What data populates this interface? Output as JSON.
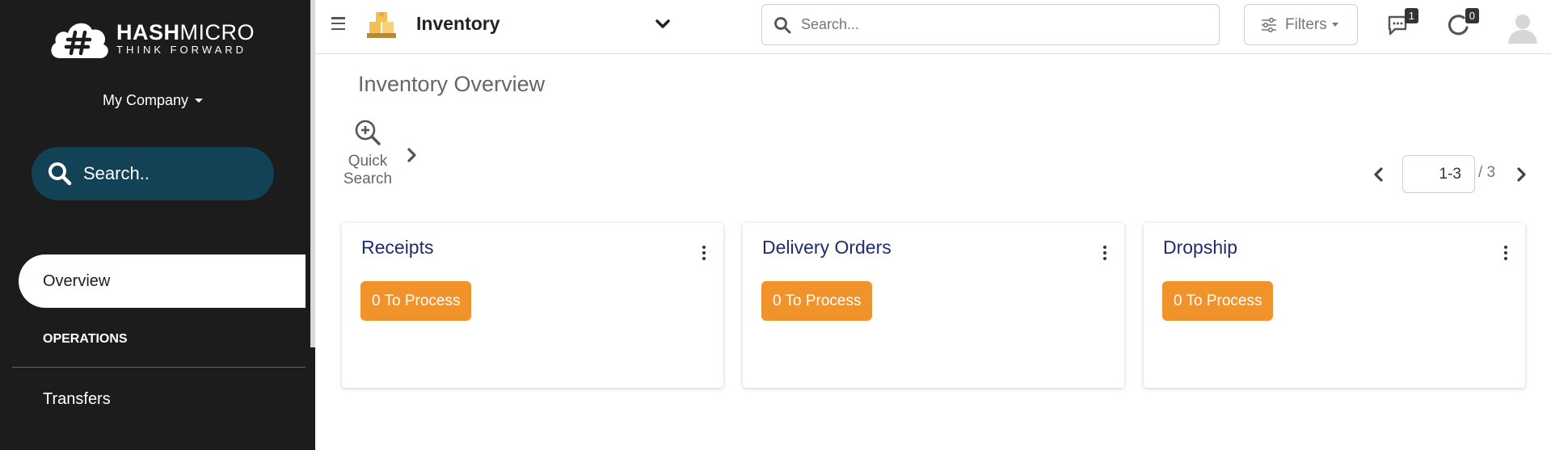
{
  "brand": {
    "name_bold": "HASH",
    "name_regular": "MICRO",
    "tagline": "THINK FORWARD"
  },
  "sidebar": {
    "company": "My Company",
    "search_label": "Search..",
    "items": [
      {
        "label": "Overview",
        "active": true
      },
      {
        "label": "OPERATIONS",
        "type": "section"
      },
      {
        "label": "Transfers"
      }
    ]
  },
  "topbar": {
    "app_title": "Inventory",
    "search_placeholder": "Search...",
    "filters_label": "Filters",
    "messages_count": "1",
    "activities_count": "0"
  },
  "main": {
    "page_title": "Inventory Overview",
    "quick_search_line1": "Quick",
    "quick_search_line2": "Search",
    "pager": {
      "range": "1-3",
      "total": "/ 3"
    },
    "cards": [
      {
        "title": "Receipts",
        "button": "0 To Process"
      },
      {
        "title": "Delivery Orders",
        "button": "0 To Process"
      },
      {
        "title": "Dropship",
        "button": "0 To Process"
      }
    ]
  },
  "colors": {
    "sidebar_bg": "#1c1c1c",
    "sidebar_search_bg": "#134156",
    "card_title": "#1e2d6b",
    "process_button": "#f0932b"
  }
}
